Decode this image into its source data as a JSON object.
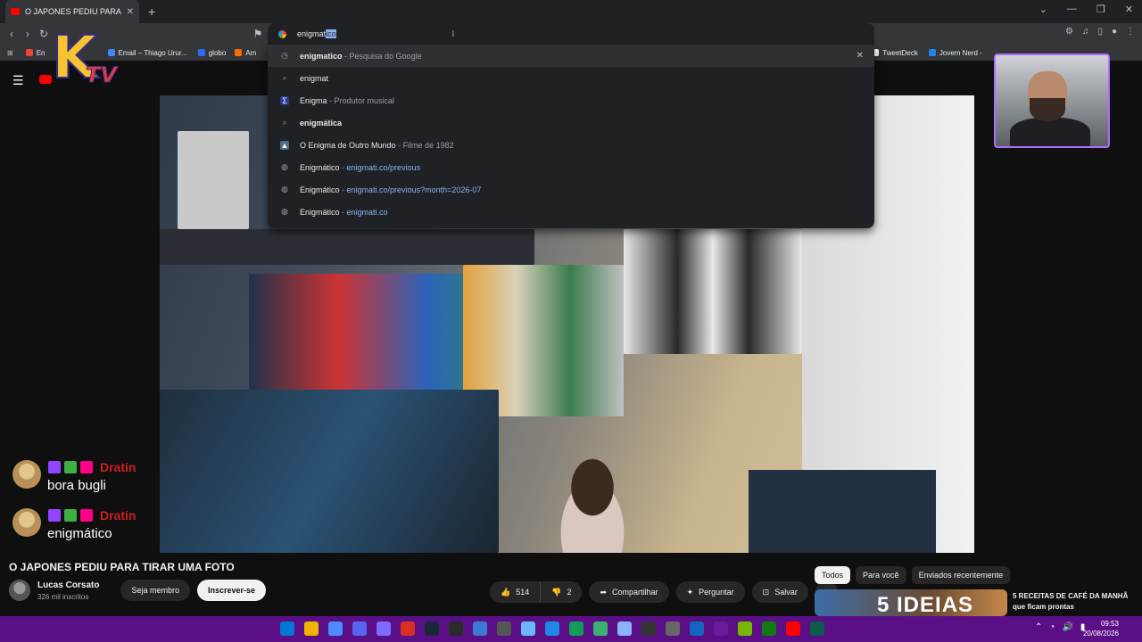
{
  "browser": {
    "tab_title": "O JAPONES PEDIU PARA TIRAR U",
    "omnibox": {
      "typed": "enigmat",
      "autocomplete": "ico"
    },
    "bookmarks": [
      {
        "label": "En",
        "color": "#ea4335"
      },
      {
        "label": "Email – Thiago Urur...",
        "color": "#4285f4"
      },
      {
        "label": "globo",
        "color": "#2d6df6"
      },
      {
        "label": "Am",
        "color": "#ff6a00"
      },
      {
        "label": "TweetDeck",
        "color": "#ffffff"
      },
      {
        "label": "Jovem Nerd -",
        "color": "#1e88e5"
      }
    ],
    "suggestions": [
      {
        "icon": "history-icon",
        "main": "enigmatico",
        "sep": " - ",
        "detail": "Pesquisa do Google"
      },
      {
        "icon": "search-icon",
        "main": "enigmat",
        "sep": "",
        "detail": ""
      },
      {
        "icon": "enigma-icon",
        "main": "Enigma",
        "sep": " - ",
        "detail": "Produtor musical"
      },
      {
        "icon": "search-icon",
        "main": "enigmática",
        "sep": "",
        "detail": ""
      },
      {
        "icon": "movie-icon",
        "main": "O Enigma de Outro Mundo",
        "sep": " - ",
        "detail": "Filme de 1982"
      },
      {
        "icon": "globe-icon",
        "main": "Enigmático",
        "sep": " - ",
        "detail": "enigmati.co/previous"
      },
      {
        "icon": "globe-icon",
        "main": "Enigmático",
        "sep": " - ",
        "detail": "enigmati.co/previous?month=2026-07"
      },
      {
        "icon": "globe-icon",
        "main": "Enigmático",
        "sep": " - ",
        "detail": "enigmati.co"
      }
    ]
  },
  "overlay": {
    "logo": {
      "k": "K",
      "tv": "TV"
    },
    "chat": [
      {
        "user": "Dratin",
        "text": "bora bugli"
      },
      {
        "user": "Dratin",
        "text": "enigmático"
      }
    ]
  },
  "video": {
    "title": "O JAPONES PEDIU PARA TIRAR UMA FOTO",
    "channel": "Lucas Corsato",
    "subscribers": "326 mil inscritos",
    "join_label": "Seja membro",
    "subscribe_label": "Inscrever-se",
    "likes": "514",
    "dislikes": "2",
    "share_label": "Compartilhar",
    "ask_label": "Perguntar",
    "save_label": "Salvar"
  },
  "sidebar": {
    "filters": [
      "Todos",
      "Para você",
      "Enviados recentemente"
    ],
    "rec_title": "5 RECEITAS DE CAFÉ DA MANHÃ que ficam prontas",
    "rec_thumb_text": "5 IDEIAS"
  },
  "taskbar": {
    "app_colors": [
      "#0078d4",
      "#f0b400",
      "#4a8cff",
      "#5865f2",
      "#7b6cff",
      "#d93025",
      "#1b2838",
      "#2b2b2b",
      "#3a7bd5",
      "#555555",
      "#6ab7ff",
      "#1e88e5",
      "#0f9d58",
      "#3bb273",
      "#8ab4f8",
      "#333333",
      "#666666",
      "#1565c0",
      "#6a1b9a",
      "#76b900",
      "#107c10",
      "#ff0000",
      "#0b5c4a"
    ],
    "time": "09:53",
    "date": "20/08/2026"
  }
}
